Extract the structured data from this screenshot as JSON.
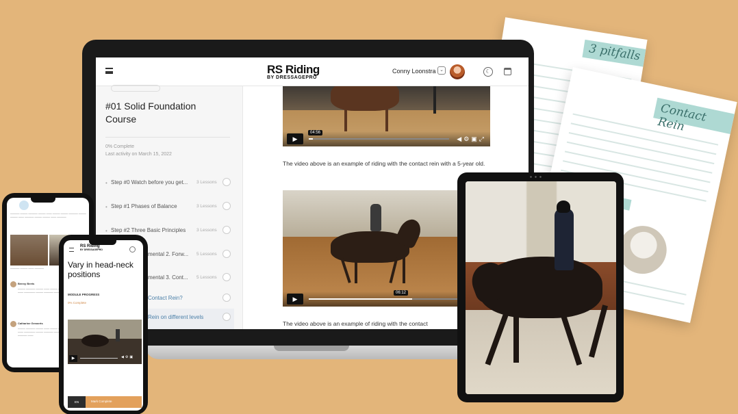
{
  "worksheets": [
    {
      "title": "3 pitfalls"
    },
    {
      "title": "Contact Rein"
    }
  ],
  "laptop": {
    "logo_main": "RS Riding",
    "logo_sub": "BY DRESSAGEPRO",
    "user_name": "Conny Loonstra",
    "course": {
      "title": "#01 Solid Foundation Course",
      "progress": "0% Complete",
      "last_activity": "Last activity on March 15, 2022",
      "steps": [
        {
          "label": "Step #0 Watch before you get...",
          "count": "3 Lessons"
        },
        {
          "label": "Step #1 Phases of Balance",
          "count": "3 Lessons"
        },
        {
          "label": "Step #2 Three Basic Principles",
          "count": "3 Lessons"
        },
        {
          "label": "mental 2. Forw...",
          "count": "5 Lessons"
        },
        {
          "label": "mental 3. Cont...",
          "count": "5 Lessons"
        },
        {
          "label": "Contact Rein?",
          "count": ""
        },
        {
          "label": "Rein on different levels",
          "count": ""
        }
      ]
    },
    "video1_time": "04:56",
    "paragraph1": "The video above is an example of riding with the contact rein with a 5-year old.",
    "video2_time": "06:12",
    "paragraph2": "The video above is an example of riding with the contact"
  },
  "phone_front": {
    "logo": "RS Riding",
    "logo_sub": "BY DRESSAGEPRO",
    "title": "Vary in head-neck positions",
    "progress_label": "MODULE PROGRESS",
    "progress_value": "0% Complete",
    "lang": "EN",
    "mark_complete": "Mark Complete"
  },
  "phone_back": {
    "comment1_name": "Benny Beets",
    "comment2_name": "Catharine Gevaerts"
  }
}
